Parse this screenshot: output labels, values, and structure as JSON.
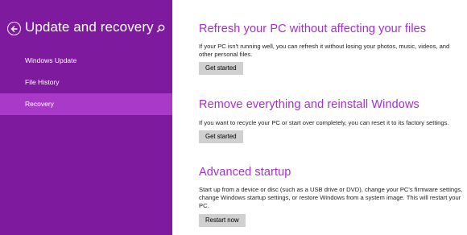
{
  "colors": {
    "sidebar_background": "#7e1a9e",
    "sidebar_selected": "#a93ac9",
    "heading_accent": "#a62ecf",
    "button_background": "#d0d0d0"
  },
  "sidebar": {
    "back_icon": "back-arrow-icon",
    "title": "Update and recovery",
    "search_icon": "search-icon",
    "items": [
      {
        "label": "Windows Update",
        "selected": false
      },
      {
        "label": "File History",
        "selected": false
      },
      {
        "label": "Recovery",
        "selected": true
      }
    ]
  },
  "main": {
    "sections": [
      {
        "heading": "Refresh your PC without affecting your files",
        "description": "If your PC isn't running well, you can refresh it without losing your photos, music, videos, and other personal files.",
        "button_label": "Get started"
      },
      {
        "heading": "Remove everything and reinstall Windows",
        "description": "If you want to recycle your PC or start over completely, you can reset it to its factory settings.",
        "button_label": "Get started"
      },
      {
        "heading": "Advanced startup",
        "description": "Start up from a device or disc (such as a USB drive or DVD), change your PC's firmware settings, change Windows startup settings, or restore Windows from a system image. This will restart your PC.",
        "button_label": "Restart now"
      }
    ]
  }
}
